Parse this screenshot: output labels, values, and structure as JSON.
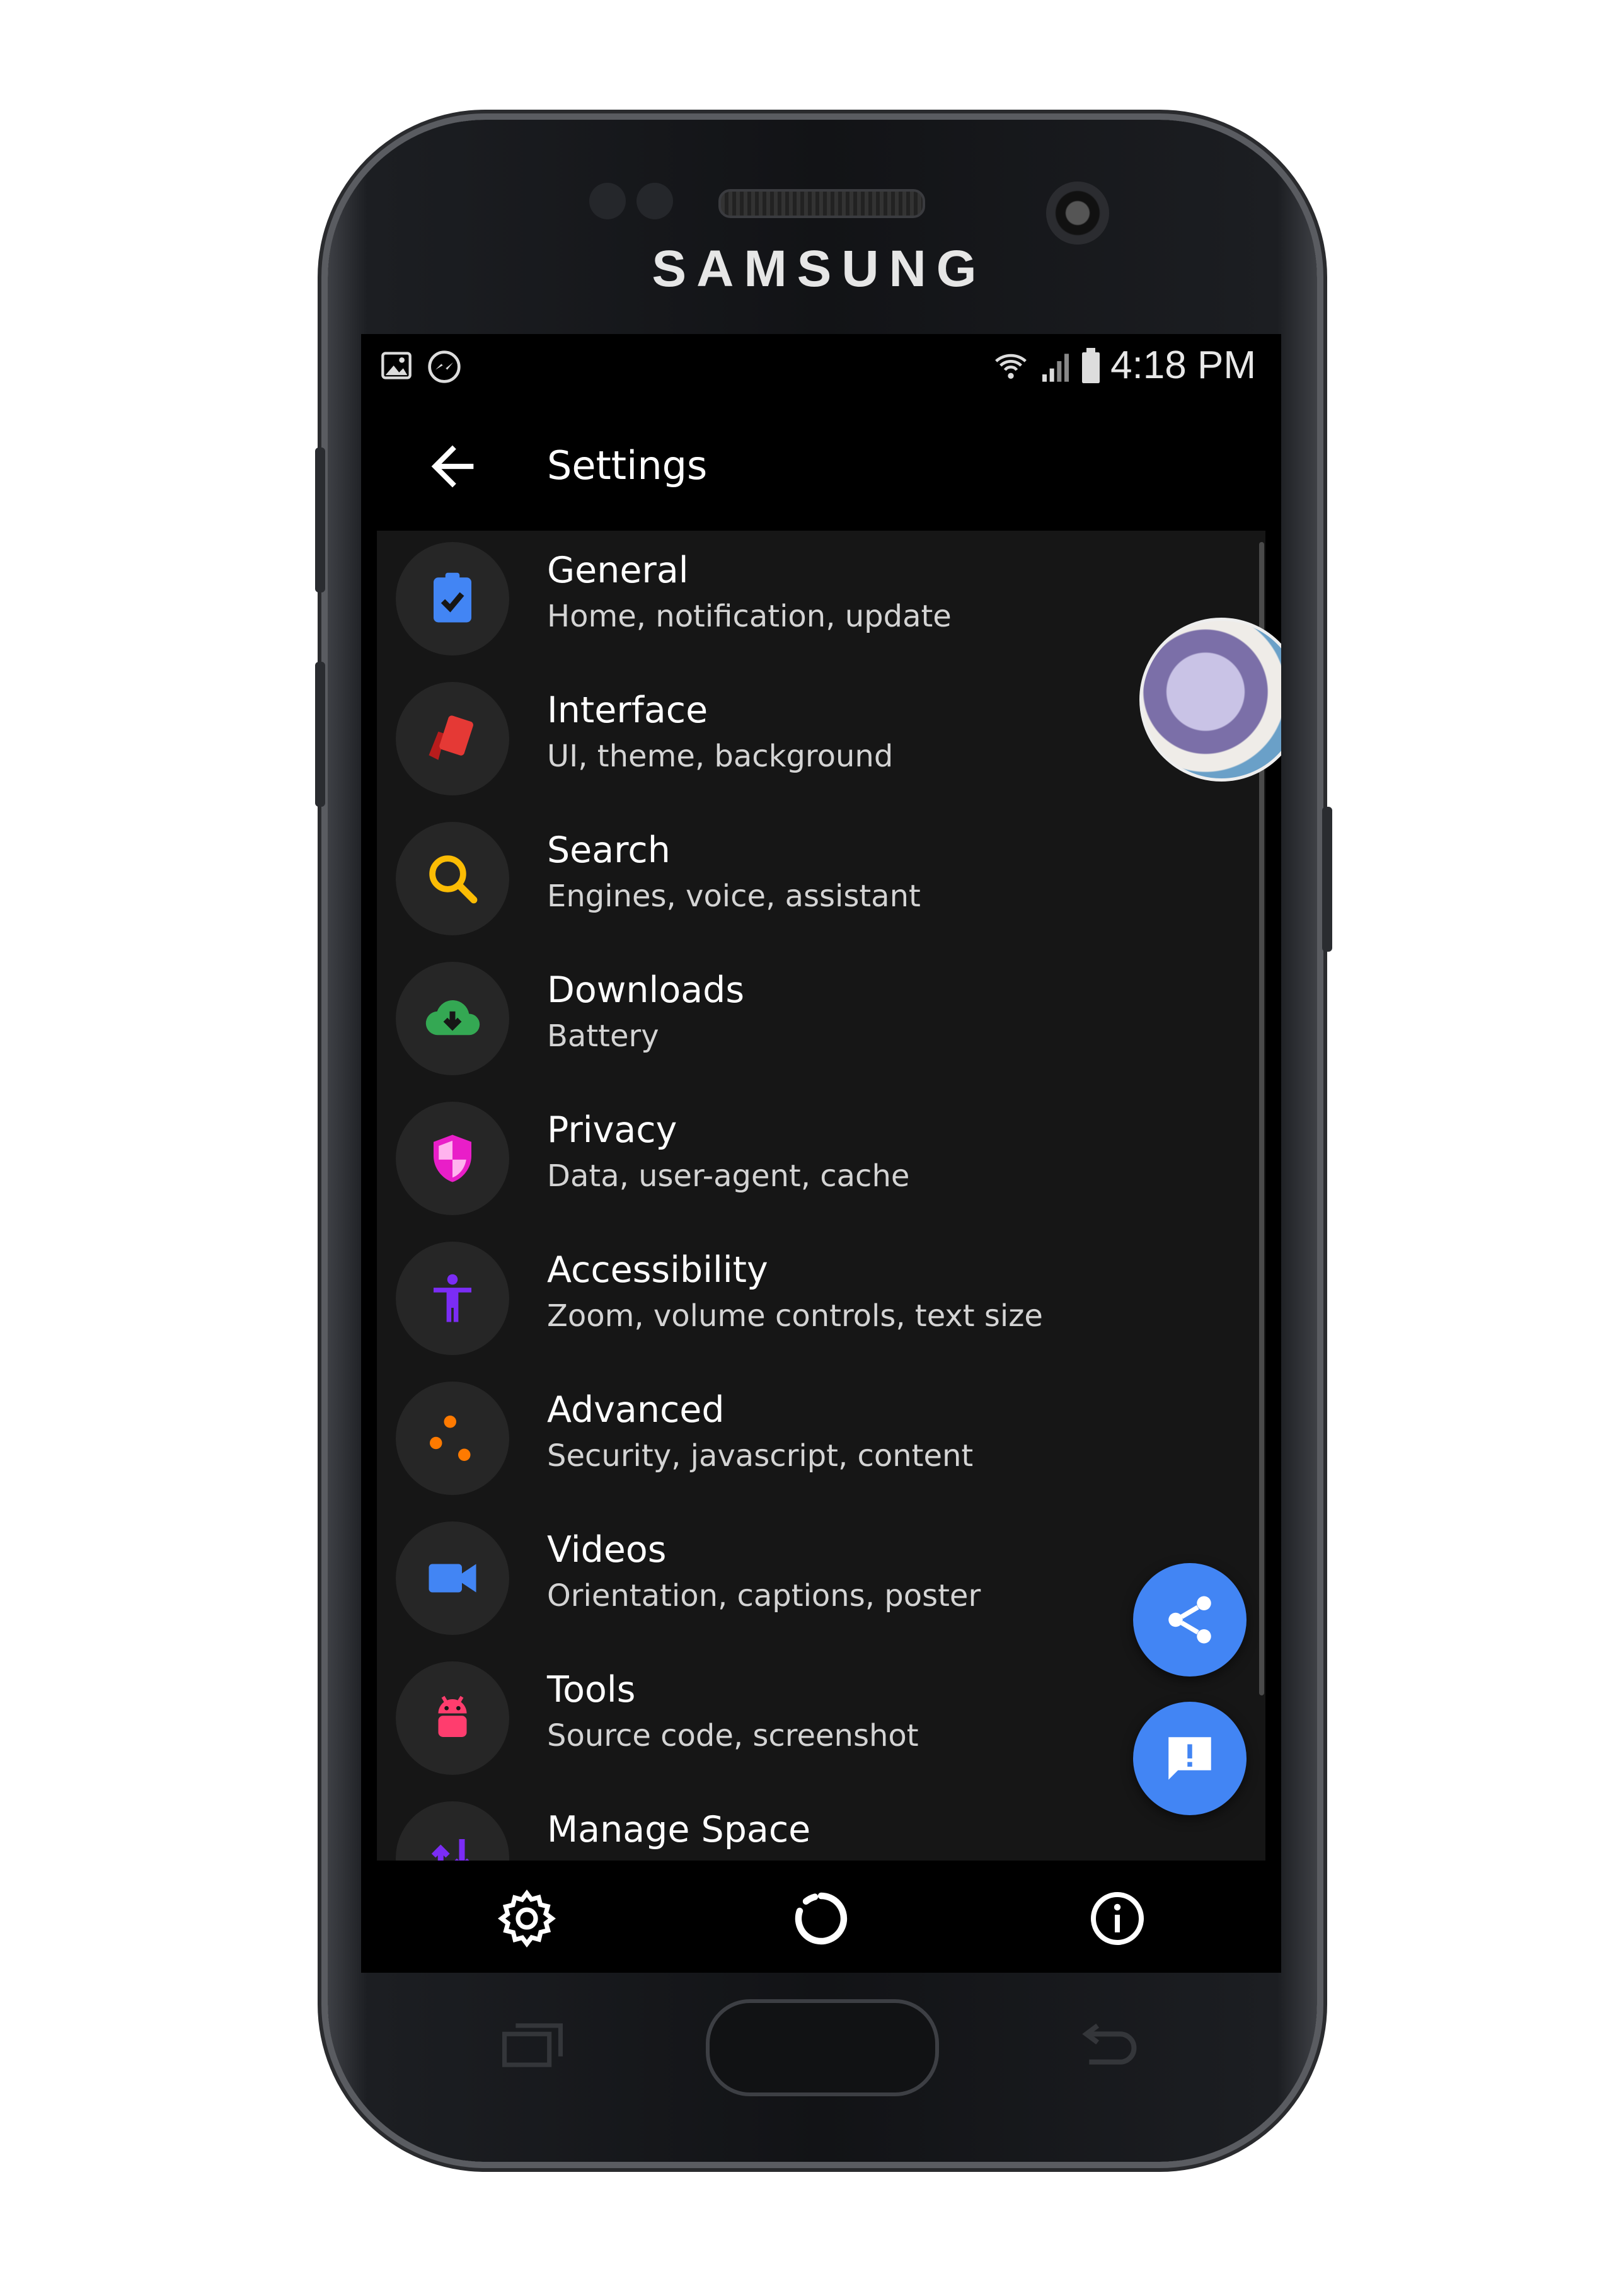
{
  "device": {
    "brand": "SAMSUNG"
  },
  "status_bar": {
    "time": "4:18 PM",
    "left_icons": [
      "image-icon",
      "messenger-icon"
    ],
    "right_icons": [
      "wifi-icon",
      "signal-icon",
      "battery-icon"
    ]
  },
  "app_bar": {
    "title": "Settings",
    "back_icon": "arrow-left-icon"
  },
  "settings": [
    {
      "title": "General",
      "subtitle": "Home, notification, update",
      "icon": "clipboard-check-icon",
      "color": "#4285f4"
    },
    {
      "title": "Interface",
      "subtitle": "UI, theme, background",
      "icon": "cards-icon",
      "color": "#e53935"
    },
    {
      "title": "Search",
      "subtitle": "Engines, voice, assistant",
      "icon": "search-icon",
      "color": "#fbbc04"
    },
    {
      "title": "Downloads",
      "subtitle": "Battery",
      "icon": "cloud-download-icon",
      "color": "#34a853"
    },
    {
      "title": "Privacy",
      "subtitle": "Data, user-agent, cache",
      "icon": "shield-icon",
      "color": "#e91ec8"
    },
    {
      "title": "Accessibility",
      "subtitle": "Zoom, volume controls, text size",
      "icon": "accessibility-icon",
      "color": "#7b2cf5"
    },
    {
      "title": "Advanced",
      "subtitle": "Security, javascript, content",
      "icon": "dots-icon",
      "color": "#ff7a00"
    },
    {
      "title": "Videos",
      "subtitle": "Orientation, captions, poster",
      "icon": "videocam-icon",
      "color": "#4285f4"
    },
    {
      "title": "Tools",
      "subtitle": "Source code, screenshot",
      "icon": "android-icon",
      "color": "#ff3d6e"
    },
    {
      "title": "Manage Space",
      "subtitle": "",
      "icon": "storage-icon",
      "color": "#7b2cf5"
    }
  ],
  "fabs": [
    {
      "name": "share",
      "icon": "share-icon",
      "color": "#4285f4"
    },
    {
      "name": "feedback",
      "icon": "feedback-icon",
      "color": "#4285f4"
    }
  ],
  "bottom_bar": {
    "icons": [
      "gear-icon",
      "loading-icon",
      "info-icon"
    ]
  },
  "chat_head": {
    "icon": "avatar-bubble"
  }
}
